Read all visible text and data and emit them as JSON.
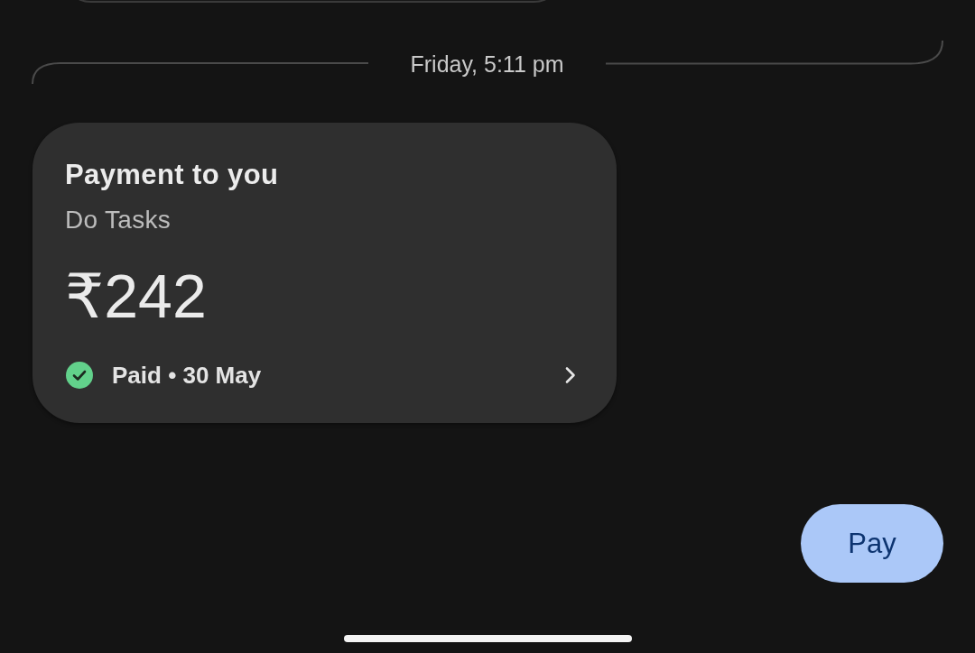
{
  "date_divider": {
    "label": "Friday, 5:11 pm"
  },
  "payment_card": {
    "title": "Payment to you",
    "subtitle": "Do Tasks",
    "amount": "₹242",
    "status": {
      "kind": "paid",
      "label": "Paid • 30 May"
    }
  },
  "pay_button": {
    "label": "Pay"
  }
}
